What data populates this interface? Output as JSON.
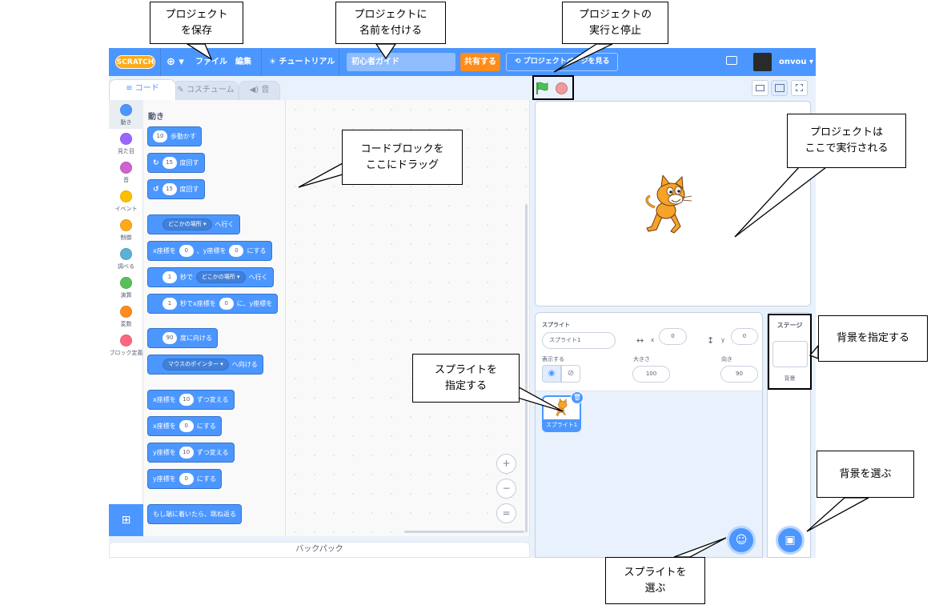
{
  "menubar": {
    "logo": "SCRATCH",
    "language_icon": "globe-icon",
    "file": "ファイル",
    "edit": "編集",
    "tutorials": "チュートリアル",
    "project_title": "初心者ガイド",
    "share": "共有する",
    "project_page": "プロジェクトページを見る",
    "username": "onvou"
  },
  "tabs": {
    "code": "コード",
    "costumes": "コスチューム",
    "sounds": "音"
  },
  "categories": [
    {
      "label": "動き",
      "color": "#4c97ff"
    },
    {
      "label": "見た目",
      "color": "#9966ff"
    },
    {
      "label": "音",
      "color": "#cf63cf"
    },
    {
      "label": "イベント",
      "color": "#ffbf00"
    },
    {
      "label": "制御",
      "color": "#ffab19"
    },
    {
      "label": "調べる",
      "color": "#5cb1d6"
    },
    {
      "label": "演算",
      "color": "#59c059"
    },
    {
      "label": "変数",
      "color": "#ff8c1a"
    },
    {
      "label": "ブロック定義",
      "color": "#ff6680"
    }
  ],
  "palette": {
    "title": "動き",
    "blocks": {
      "move": {
        "value": "10",
        "text": "歩動かす"
      },
      "turn_right": {
        "value": "15",
        "text": "度回す"
      },
      "turn_left": {
        "value": "15",
        "text": "度回す"
      },
      "goto": {
        "dropdown": "どこかの場所",
        "text": "へ行く"
      },
      "goto_xy": {
        "x_label": "x座標を",
        "x": "0",
        "mid": "、y座標を",
        "y": "0",
        "end": "にする"
      },
      "glide": {
        "value": "1",
        "mid": "秒で",
        "dropdown": "どこかの場所",
        "end": "へ行く"
      },
      "glide_xy": {
        "value": "1",
        "mid": "秒でx座標を",
        "x": "0",
        "mid2": "に、y座標を"
      },
      "point_dir": {
        "value": "90",
        "text": "度に向ける"
      },
      "point_towards": {
        "dropdown": "マウスのポインター",
        "text": "へ向ける"
      },
      "change_x": {
        "label": "x座標を",
        "value": "10",
        "text": "ずつ変える"
      },
      "set_x": {
        "label": "x座標を",
        "value": "0",
        "text": "にする"
      },
      "change_y": {
        "label": "y座標を",
        "value": "10",
        "text": "ずつ変える"
      },
      "set_y": {
        "label": "y座標を",
        "value": "0",
        "text": "にする"
      },
      "bounce": {
        "text": "もし端に着いたら、跳ね返る"
      }
    }
  },
  "zoom": {
    "in": "+",
    "out": "−",
    "reset": "="
  },
  "backpack": "バックパック",
  "sprite_info": {
    "sprite_label": "スプライト",
    "sprite_name": "スプライト1",
    "x_label": "x",
    "x_value": "0",
    "y_label": "y",
    "y_value": "0",
    "show_label": "表示する",
    "size_label": "大きさ",
    "size_value": "100",
    "direction_label": "向き",
    "direction_value": "90"
  },
  "sprite_list": [
    {
      "name": "スプライト1"
    }
  ],
  "stage_pane": {
    "title": "ステージ",
    "backdrops_label": "背景"
  },
  "callouts": {
    "save": "プロジェクト\nを保存",
    "name": "プロジェクトに\n名前を付ける",
    "run_stop": "プロジェクトの\n実行と停止",
    "code_drag": "コードブロックを\nここにドラッグ",
    "runs_here": "プロジェクトは\nここで実行される",
    "set_backdrop": "背景を指定する",
    "set_sprite": "スプライトを\n指定する",
    "choose_backdrop": "背景を選ぶ",
    "choose_sprite": "スプライトを\n選ぶ"
  },
  "colors": {
    "menubar": "#4c97ff",
    "share": "#ff8c1a",
    "motion": "#4c97ff",
    "background": "#e9f1fc"
  }
}
